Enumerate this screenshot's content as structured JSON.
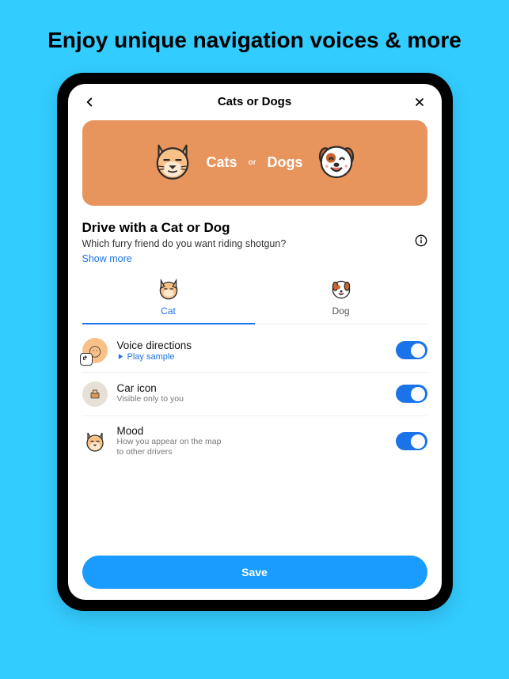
{
  "promo": "Enjoy unique navigation voices & more",
  "header": {
    "title": "Cats or Dogs"
  },
  "banner": {
    "lhs": "Cats",
    "or": "or",
    "rhs": "Dogs"
  },
  "section": {
    "title": "Drive with a Cat or Dog",
    "subtitle": "Which furry friend do you want riding shotgun?",
    "show_more": "Show more"
  },
  "tabs": [
    {
      "label": "Cat",
      "active": true
    },
    {
      "label": "Dog",
      "active": false
    }
  ],
  "settings": [
    {
      "title": "Voice directions",
      "play_sample": "Play sample",
      "toggle": true
    },
    {
      "title": "Car icon",
      "subtitle": "Visible only to you",
      "toggle": true
    },
    {
      "title": "Mood",
      "subtitle": "How you appear on the map\nto other drivers",
      "toggle": true
    }
  ],
  "save_label": "Save"
}
